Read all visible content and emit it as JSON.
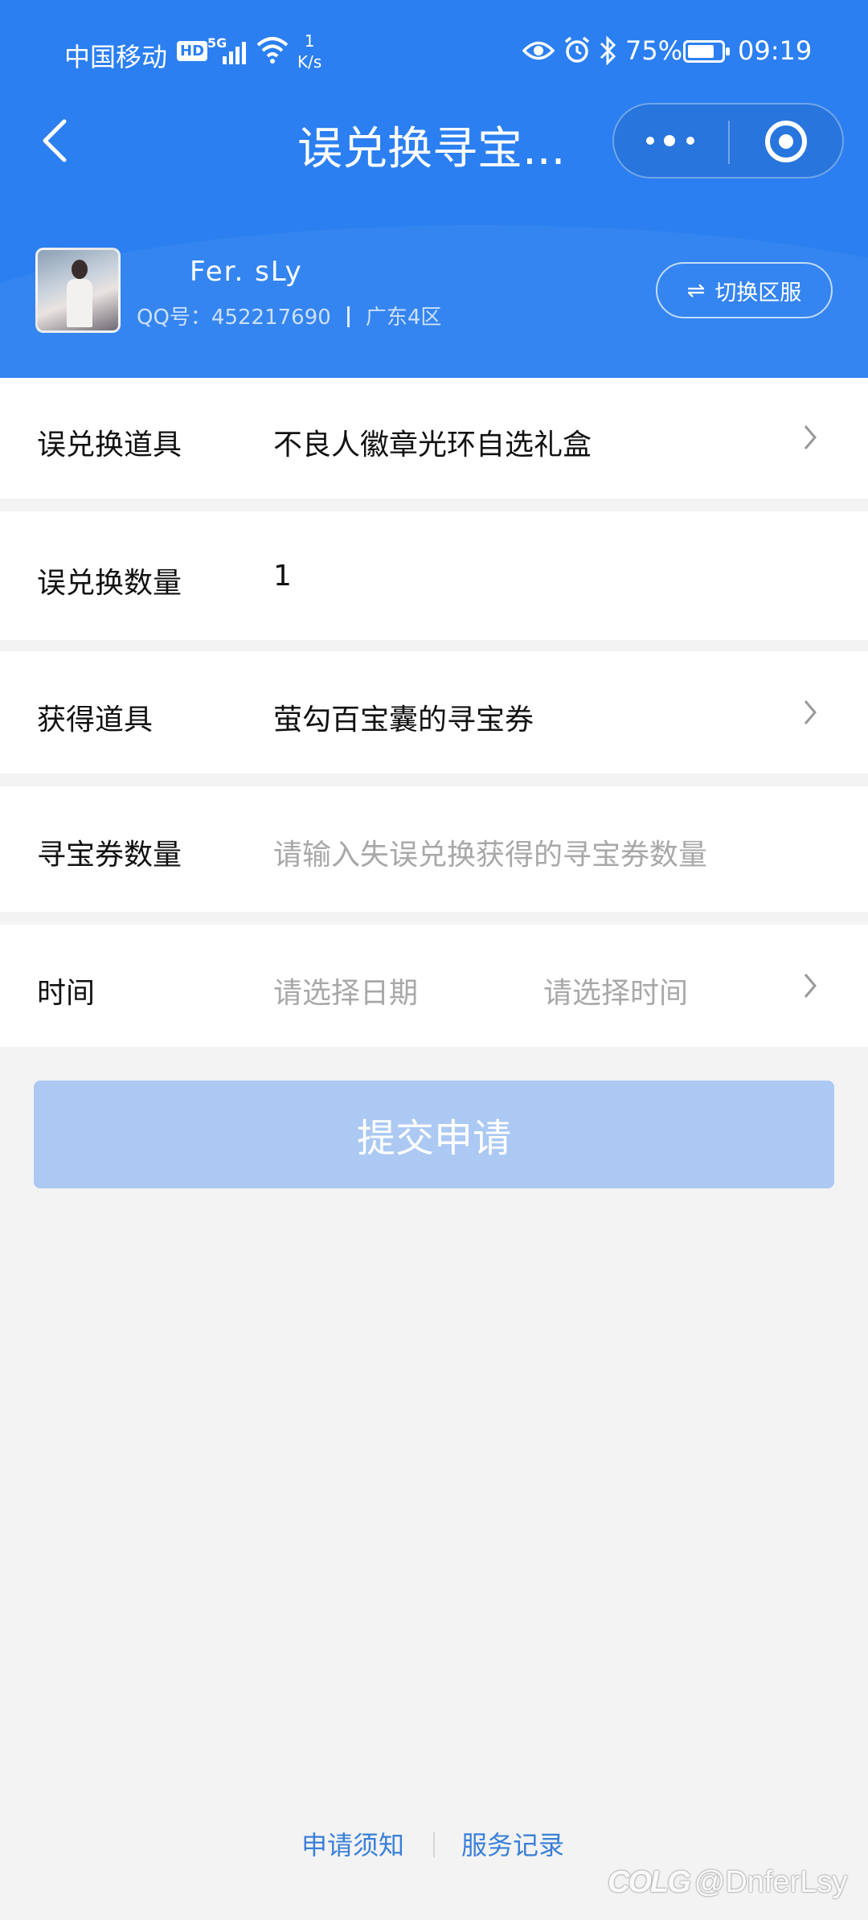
{
  "status_bar": {
    "carrier": "中国移动",
    "hd": "HD",
    "network": "5G",
    "speed_value": "1",
    "speed_unit": "K/s",
    "battery": "75%",
    "time": "09:19"
  },
  "nav": {
    "title": "误兑换寻宝..."
  },
  "user": {
    "name": "Fer. sLy",
    "qq_label": "QQ号：452217690",
    "region": "广东4区",
    "switch_label": "切换区服",
    "switch_icon": "⇌"
  },
  "form": {
    "item": {
      "label": "误兑换道具",
      "value": "不良人徽章光环自选礼盒"
    },
    "quantity": {
      "label": "误兑换数量",
      "value": "1"
    },
    "obtained": {
      "label": "获得道具",
      "value": "萤勾百宝囊的寻宝券"
    },
    "ticket_qty": {
      "label": "寻宝券数量",
      "placeholder": "请输入失误兑换获得的寻宝券数量"
    },
    "time": {
      "label": "时间",
      "date_placeholder": "请选择日期",
      "time_placeholder": "请选择时间"
    }
  },
  "submit_label": "提交申请",
  "footer": {
    "notice": "申请须知",
    "records": "服务记录"
  },
  "watermark": {
    "logo": "COLG",
    "handle": "@DnferLsy"
  },
  "colors": {
    "header_blue": "#2b7ff0",
    "submit_disabled": "#abc9f2",
    "link": "#3a7fd8"
  }
}
